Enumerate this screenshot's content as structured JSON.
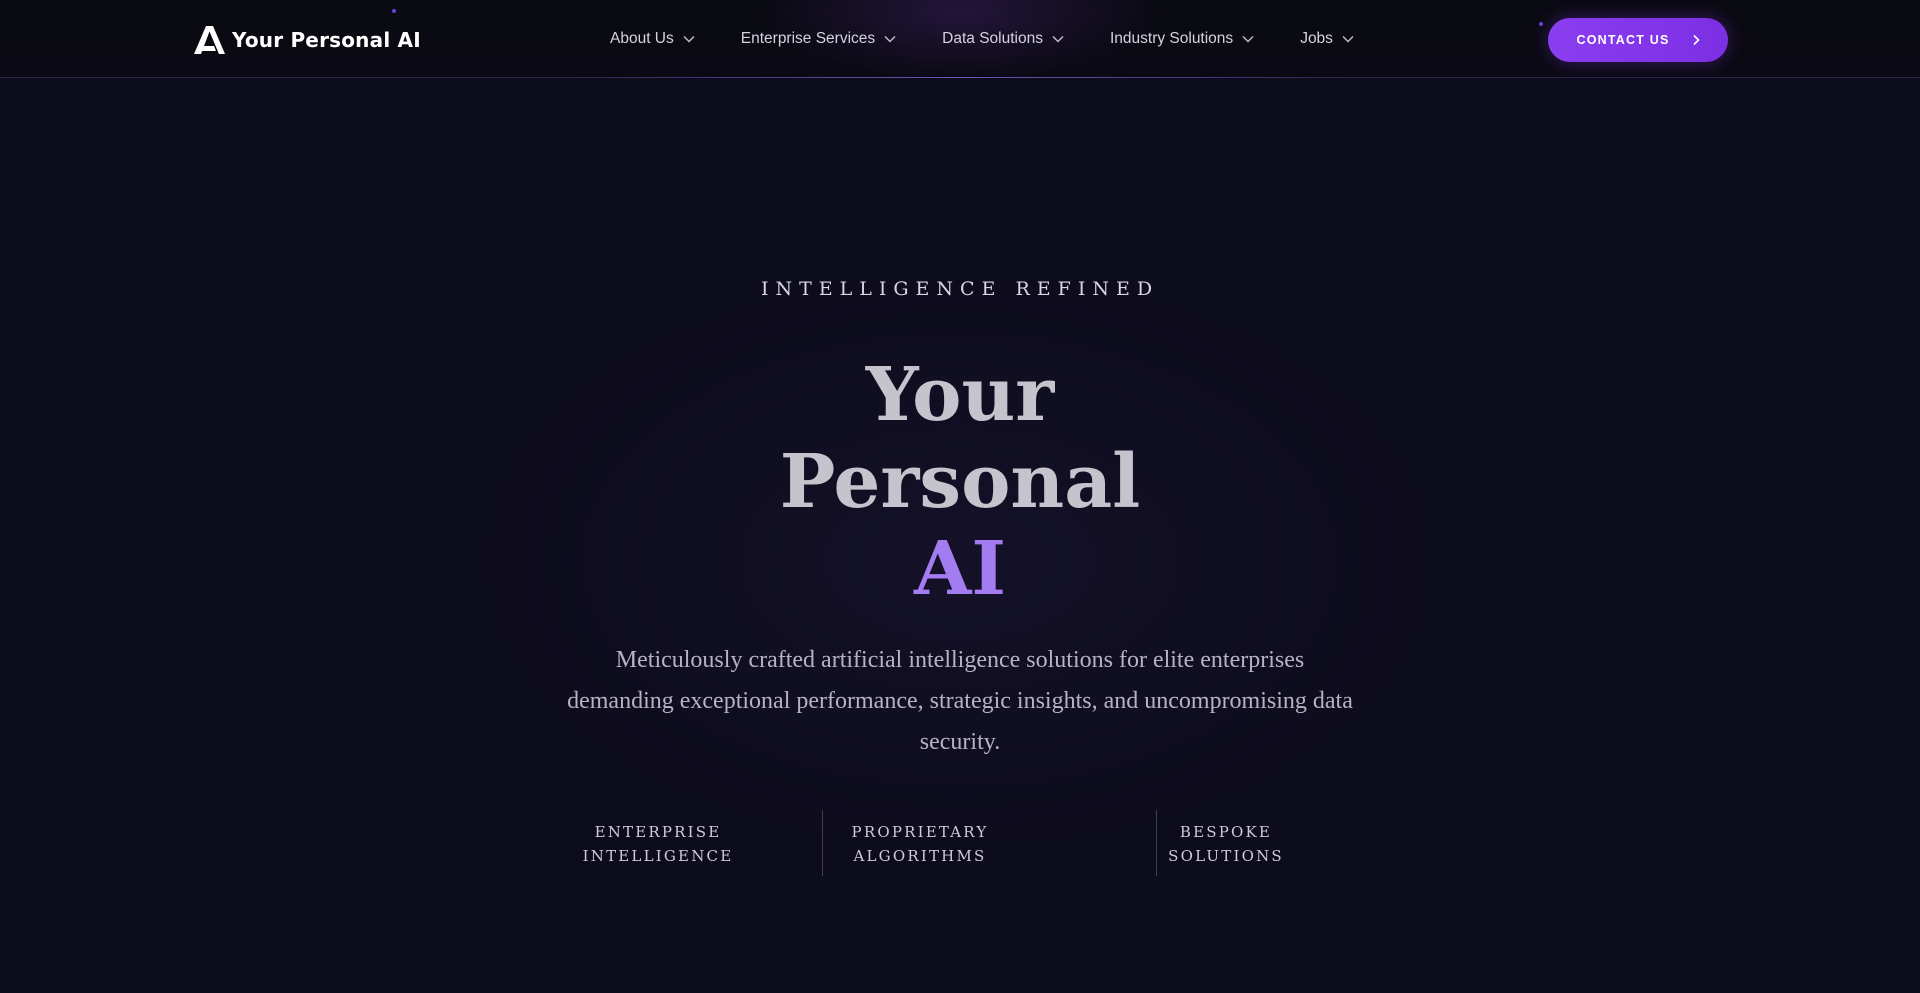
{
  "brand": {
    "name": "Your Personal AI",
    "logo_icon": "a-logo-icon",
    "accent_color": "#8b3df0",
    "title_accent_color": "#a47cf2"
  },
  "nav": {
    "items": [
      {
        "label": "About Us",
        "icon": "chevron-down-icon"
      },
      {
        "label": "Enterprise Services",
        "icon": "chevron-down-icon"
      },
      {
        "label": "Data Solutions",
        "icon": "chevron-down-icon"
      },
      {
        "label": "Industry Solutions",
        "icon": "chevron-down-icon"
      },
      {
        "label": "Jobs",
        "icon": "chevron-down-icon"
      }
    ],
    "contact": {
      "label": "CONTACT US",
      "icon": "chevron-right-icon"
    }
  },
  "hero": {
    "eyebrow": "INTELLIGENCE REFINED",
    "title_line1": "Your",
    "title_line2": "Personal",
    "title_line3": "AI",
    "description": "Meticulously crafted artificial intelligence solutions for elite enterprises demanding exceptional performance, strategic insights, and uncompromising data security."
  },
  "features": [
    {
      "line1": "ENTERPRISE",
      "line2": "INTELLIGENCE"
    },
    {
      "line1": "PROPRIETARY",
      "line2": "ALGORITHMS"
    },
    {
      "line1": "BESPOKE",
      "line2": "SOLUTIONS"
    }
  ]
}
